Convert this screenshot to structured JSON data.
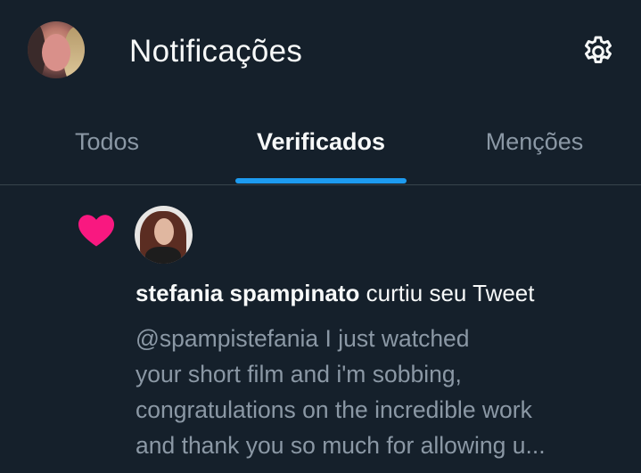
{
  "header": {
    "title": "Notificações",
    "avatar_icon": "user-avatar",
    "settings_icon": "gear-icon"
  },
  "tabs": [
    {
      "label": "Todos",
      "active": false
    },
    {
      "label": "Verificados",
      "active": true
    },
    {
      "label": "Menções",
      "active": false
    }
  ],
  "notification": {
    "icon": "heart-icon",
    "icon_color": "#f91880",
    "user_name": "stefania spampinato",
    "action": "curtiu seu Tweet",
    "tweet_lines": [
      "@spampistefania I just watched",
      "your short film and i'm sobbing,",
      "congratulations on the incredible work",
      "and thank you so much for allowing u..."
    ]
  },
  "colors": {
    "background": "#15202b",
    "accent": "#1d9bf0",
    "text_primary": "#f7f9f9",
    "text_secondary": "#8b98a5",
    "divider": "#38444d"
  }
}
